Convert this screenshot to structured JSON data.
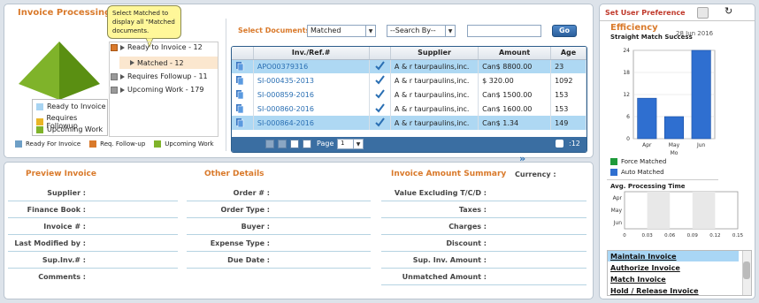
{
  "invoice_processing": {
    "title": "Invoice Processing",
    "tooltip": "Select Matched to display all \"Matched documents.",
    "tree": [
      {
        "label": "Ready to Invoice - 12"
      },
      {
        "label": "Matched - 12"
      },
      {
        "label": "Requires Followup - 11"
      },
      {
        "label": "Upcoming Work - 179"
      }
    ],
    "pyramid_legend": [
      "Ready to Invoice",
      "Requires Followup",
      "Upcoming Work"
    ],
    "bottom_legend": [
      "Ready For Invoice",
      "Req. Follow-up",
      "Upcoming Work"
    ]
  },
  "toolbar": {
    "select_documents_label": "Select Documents",
    "documents_value": "Matched",
    "search_by_value": "--Search By--",
    "search_text": "",
    "go_label": "Go"
  },
  "grid": {
    "columns": [
      "Inv./Ref.#",
      "Supplier",
      "Amount",
      "Age"
    ],
    "rows": [
      {
        "ref": "APO00379316",
        "supplier": "A & r taurpaulins,inc.",
        "amount": "Can$ 8800.00",
        "age": "23"
      },
      {
        "ref": "SI-000435-2013",
        "supplier": "A & r taurpaulins,inc.",
        "amount": "$ 320.00",
        "age": "1092"
      },
      {
        "ref": "SI-000859-2016",
        "supplier": "A & r taurpaulins,inc.",
        "amount": "Can$ 1500.00",
        "age": "153"
      },
      {
        "ref": "SI-000860-2016",
        "supplier": "A & r taurpaulins,inc.",
        "amount": "Can$ 1600.00",
        "age": "153"
      },
      {
        "ref": "SI-000864-2016",
        "supplier": "A & r taurpaulins,inc.",
        "amount": "Can$ 1.34",
        "age": "149"
      }
    ],
    "pager": {
      "page_label": "Page",
      "page_value": "1",
      "count": ":12"
    }
  },
  "preview": {
    "preview_title": "Preview Invoice",
    "other_title": "Other Details",
    "summary_title": "Invoice Amount Summary",
    "currency_label": "Currency :",
    "preview_fields": [
      "Supplier :",
      "Finance Book :",
      "Invoice # :",
      "Last Modified by :",
      "Sup.Inv.# :",
      "Comments :"
    ],
    "other_fields": [
      "Order # :",
      "Order Type :",
      "Buyer :",
      "Expense Type :",
      "Due Date :"
    ],
    "summary_fields": [
      "Value Excluding T/C/D :",
      "Taxes :",
      "Charges :",
      "Discount :",
      "Sup. Inv. Amount :",
      "Unmatched Amount :"
    ]
  },
  "right": {
    "set_pref": "Set User Preference",
    "efficiency": "Efficiency",
    "straight_match": "Straight Match Success",
    "date": "28 Jun 2016",
    "legend": [
      "Force Matched",
      "Auto Matched"
    ],
    "avg_title": "Avg. Processing Time",
    "links": [
      "Maintain Invoice",
      "Authorize Invoice",
      "Match Invoice",
      "Hold / Release Invoice"
    ]
  },
  "chart_data": [
    {
      "type": "bar",
      "title": "Straight Match Success",
      "categories": [
        "Apr",
        "May",
        "Jun"
      ],
      "xlabel": "Mo",
      "series": [
        {
          "name": "Auto Matched",
          "values": [
            11,
            6,
            24
          ]
        }
      ],
      "ylim": [
        0,
        24
      ],
      "yticks": [
        0,
        6,
        12,
        18,
        24
      ]
    },
    {
      "type": "bar",
      "title": "Avg. Processing Time",
      "categories": [
        "Apr",
        "May",
        "Jun"
      ],
      "values": [
        0,
        0,
        0
      ],
      "xlim": [
        0,
        0.15
      ],
      "xticks": [
        "0",
        "0.03",
        "0.06",
        "0.09",
        "0.12",
        "0.15"
      ]
    }
  ]
}
